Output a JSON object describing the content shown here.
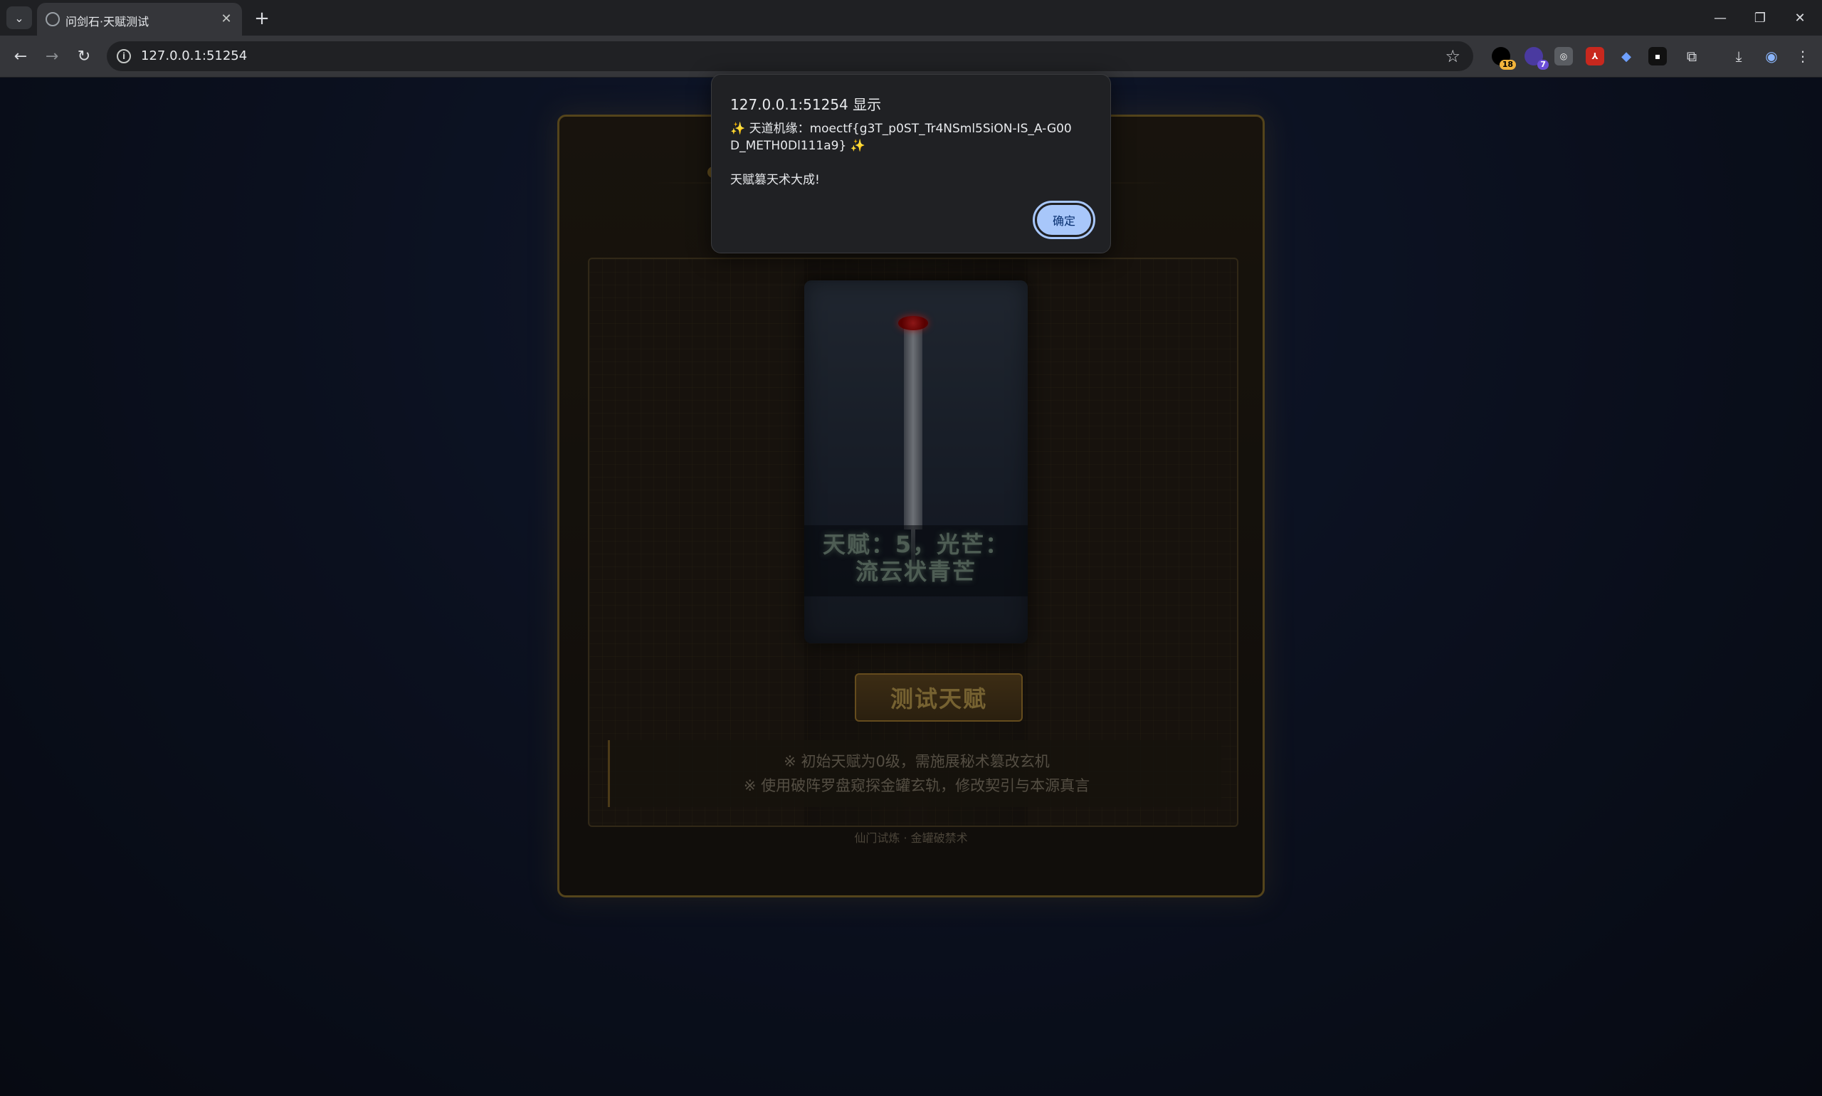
{
  "browser": {
    "tab_title": "问剑石·天赋测试",
    "url": "127.0.0.1:51254",
    "extension_badges": [
      "18",
      "7"
    ],
    "colors": {
      "tabbar": "#1f2023",
      "toolbar": "#35363a",
      "accent": "#a8c7fa"
    }
  },
  "page": {
    "result_line1": "天赋：5，光芒：",
    "result_line2": "流云状青芒",
    "test_button": "测试天赋",
    "hint_line1": "※ 初始天赋为0级，需施展秘术篡改玄机",
    "hint_line2": "※ 使用破阵罗盘窥探金罐玄轨，修改契引与本源真言",
    "footer": "仙门试炼 · 金罐破禁术",
    "colors": {
      "gold": "#b88a36",
      "result_glow": "#8fa99a"
    }
  },
  "dialog": {
    "title": "127.0.0.1:51254 显示",
    "message": "✨ 天道机缘：moectf{g3T_p0ST_Tr4NSml5SiON-IS_A-G00D_METH0Dl111a9} ✨\n\n天赋篡天术大成!",
    "ok_button": "确定"
  }
}
